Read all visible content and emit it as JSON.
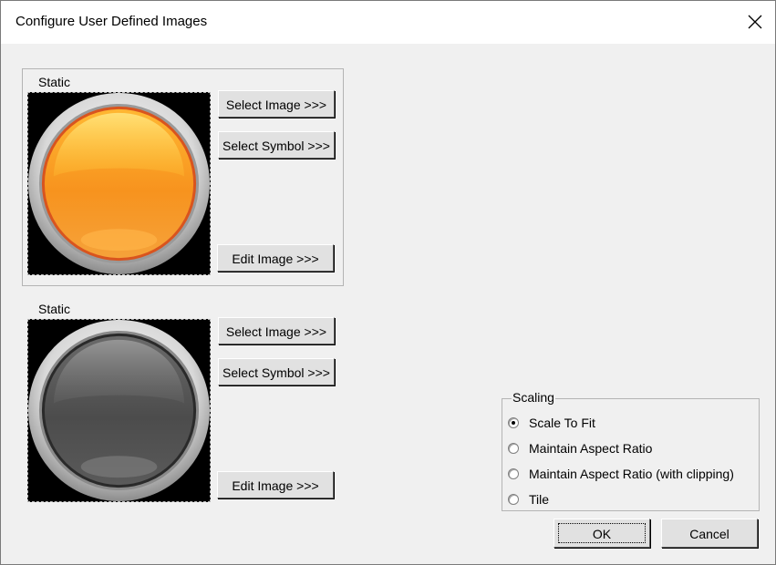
{
  "window": {
    "title": "Configure User Defined Images",
    "close_glyph": "✕"
  },
  "image_groups": [
    {
      "label": "Static",
      "image": "orange-round-button-icon",
      "image_color": "#f7931e",
      "select_image_label": "Select Image >>>",
      "select_symbol_label": "Select Symbol >>>",
      "edit_image_label": "Edit Image >>>"
    },
    {
      "label": "Static",
      "image": "gray-round-button-icon",
      "image_color": "#5a5a5a",
      "select_image_label": "Select Image >>>",
      "select_symbol_label": "Select Symbol >>>",
      "edit_image_label": "Edit Image >>>"
    }
  ],
  "scaling": {
    "label": "Scaling",
    "options": [
      {
        "label": "Scale To Fit",
        "checked": true
      },
      {
        "label": "Maintain Aspect Ratio",
        "checked": false
      },
      {
        "label": "Maintain Aspect Ratio (with clipping)",
        "checked": false
      },
      {
        "label": "Tile",
        "checked": false
      }
    ]
  },
  "footer": {
    "ok_label": "OK",
    "cancel_label": "Cancel"
  }
}
